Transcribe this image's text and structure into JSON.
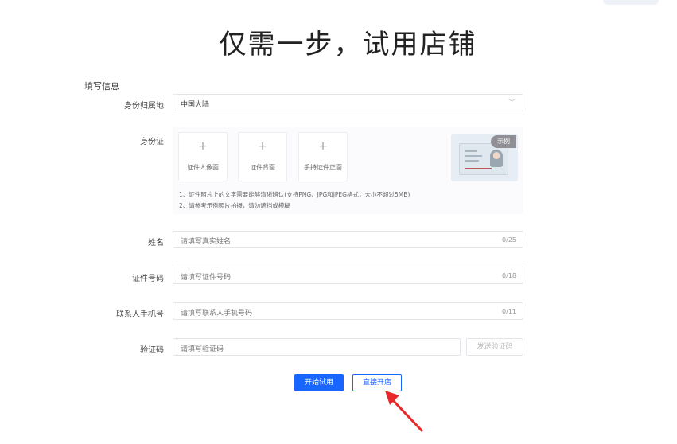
{
  "title": "仅需一步，试用店铺",
  "section_title": "填写信息",
  "region": {
    "label": "身份归属地",
    "value": "中国大陆"
  },
  "id_card": {
    "label": "身份证",
    "uploads": [
      {
        "caption": "证件人像面"
      },
      {
        "caption": "证件背面"
      },
      {
        "caption": "手持证件正面"
      }
    ],
    "notes": [
      "1、证件照片上的文字需要能够清晰辨认(支持PNG、JPG和JPEG格式，大小不超过5MB)",
      "2、请参考示例照片拍摄，请勿遮挡或模糊"
    ],
    "sample_badge": "示例"
  },
  "name": {
    "label": "姓名",
    "placeholder": "请填写真实姓名",
    "count": "0/25"
  },
  "id_number": {
    "label": "证件号码",
    "placeholder": "请填写证件号码",
    "count": "0/18"
  },
  "phone": {
    "label": "联系人手机号",
    "placeholder": "请填写联系人手机号码",
    "count": "0/11"
  },
  "verify": {
    "label": "验证码",
    "placeholder": "请填写验证码",
    "send_label": "发送验证码"
  },
  "actions": {
    "primary": "开始试用",
    "secondary": "直接开店"
  },
  "colors": {
    "accent": "#1966ff",
    "annotation": "#e8282b"
  }
}
